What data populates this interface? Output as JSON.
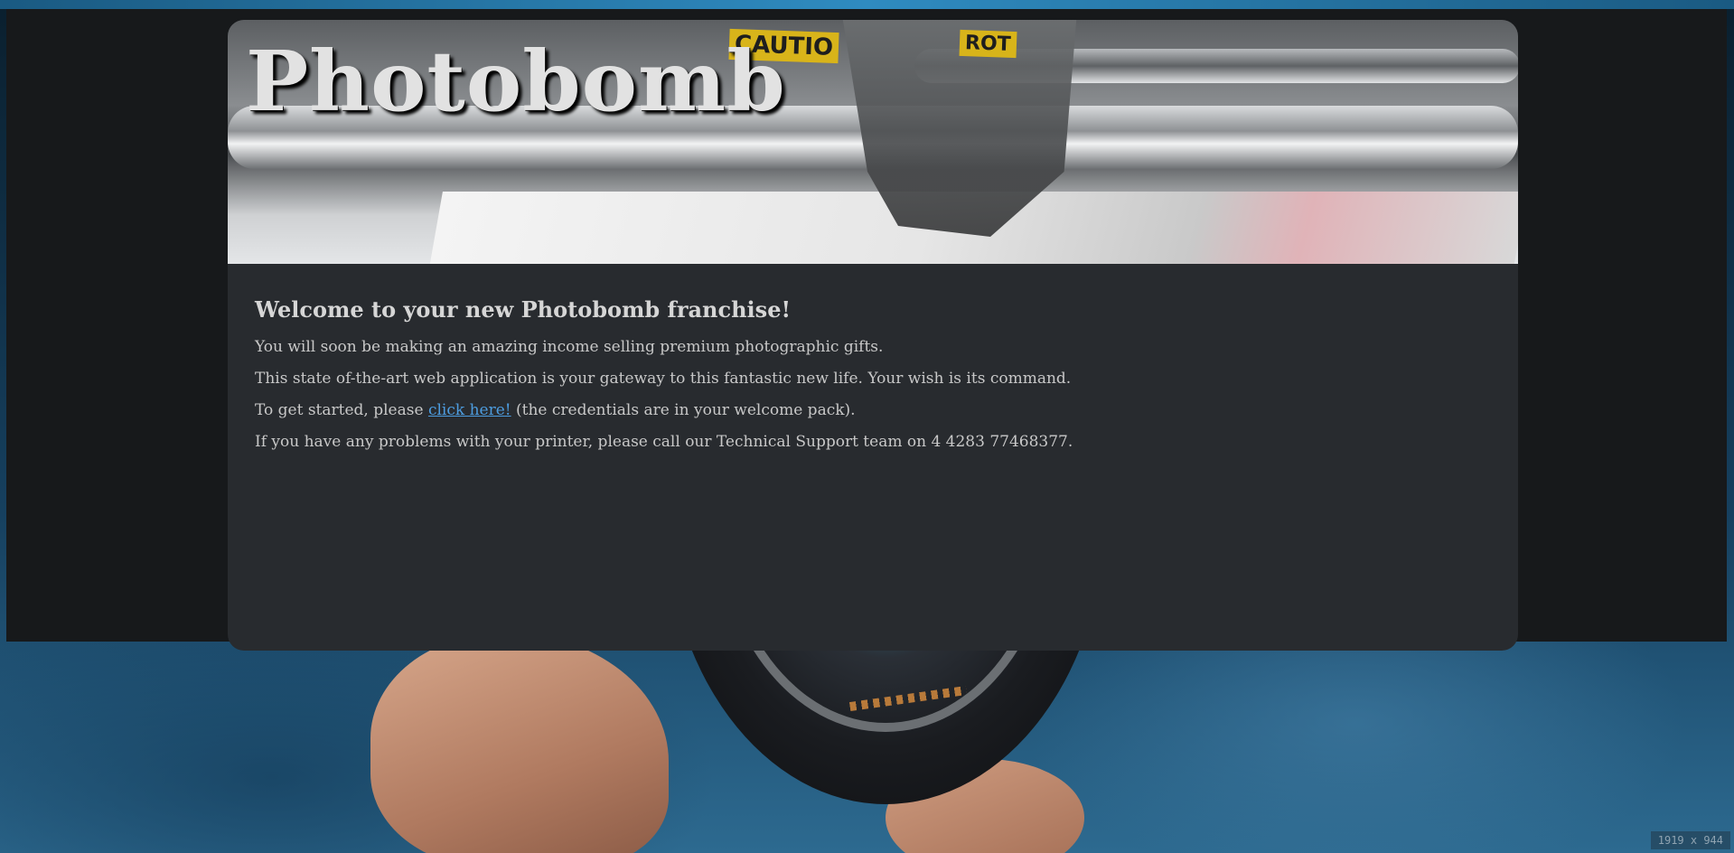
{
  "header": {
    "title": "Photobomb",
    "sign_caution": "CAUTIO",
    "sign_rot": "ROT"
  },
  "main": {
    "heading": "Welcome to your new Photobomb franchise!",
    "line1": "You will soon be making an amazing income selling premium photographic gifts.",
    "line2": "This state of-the-art web application is your gateway to this fantastic new life. Your wish is its command.",
    "line3_before": "To get started, please ",
    "line3_link": "click here!",
    "line3_after": " (the credentials are in your welcome pack).",
    "line4": "If you have any problems with your printer, please call our Technical Support team on 4 4283 77468377."
  },
  "overlay": {
    "dimensions": "1919 x 944"
  },
  "colors": {
    "link": "#4d9de0",
    "card_background": "#282b2f",
    "outer_panel": "#17191b",
    "accent_bar": "#2f8bc0"
  }
}
